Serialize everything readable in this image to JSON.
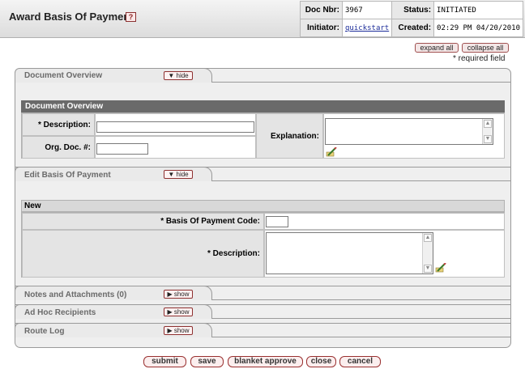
{
  "header": {
    "title": "Award Basis Of Payment",
    "help_icon": "question-mark-icon",
    "doc_nbr_label": "Doc Nbr:",
    "doc_nbr": "3967",
    "status_label": "Status:",
    "status": "INITIATED",
    "initiator_label": "Initiator:",
    "initiator": "quickstart",
    "created_label": "Created:",
    "created": "02:29 PM 04/20/2010"
  },
  "toolbar": {
    "expand_all": "expand all",
    "collapse_all": "collapse all",
    "required_note": "* required field"
  },
  "tabs": {
    "document_overview": {
      "label": "Document Overview",
      "button": "hide"
    },
    "edit_basis": {
      "label": "Edit Basis Of Payment",
      "button": "hide"
    },
    "notes": {
      "label": "Notes and Attachments (0)",
      "button": "show"
    },
    "adhoc": {
      "label": "Ad Hoc Recipients",
      "button": "show"
    },
    "route_log": {
      "label": "Route Log",
      "button": "show"
    }
  },
  "document_overview": {
    "section_title": "Document Overview",
    "description_label": "* Description:",
    "description_value": "",
    "org_doc_label": "Org. Doc. #:",
    "org_doc_value": "",
    "explanation_label": "Explanation:",
    "explanation_value": ""
  },
  "edit_basis": {
    "new_label": "New",
    "code_label": "* Basis Of Payment Code:",
    "code_value": "",
    "description_label": "* Description:",
    "description_value": ""
  },
  "actions": {
    "submit": "submit",
    "save": "save",
    "blanket_approve": "blanket approve",
    "close": "close",
    "cancel": "cancel"
  },
  "colors": {
    "section_bar": "#6a6a6a",
    "button_border": "#9a3030",
    "link": "#1c2c99"
  }
}
